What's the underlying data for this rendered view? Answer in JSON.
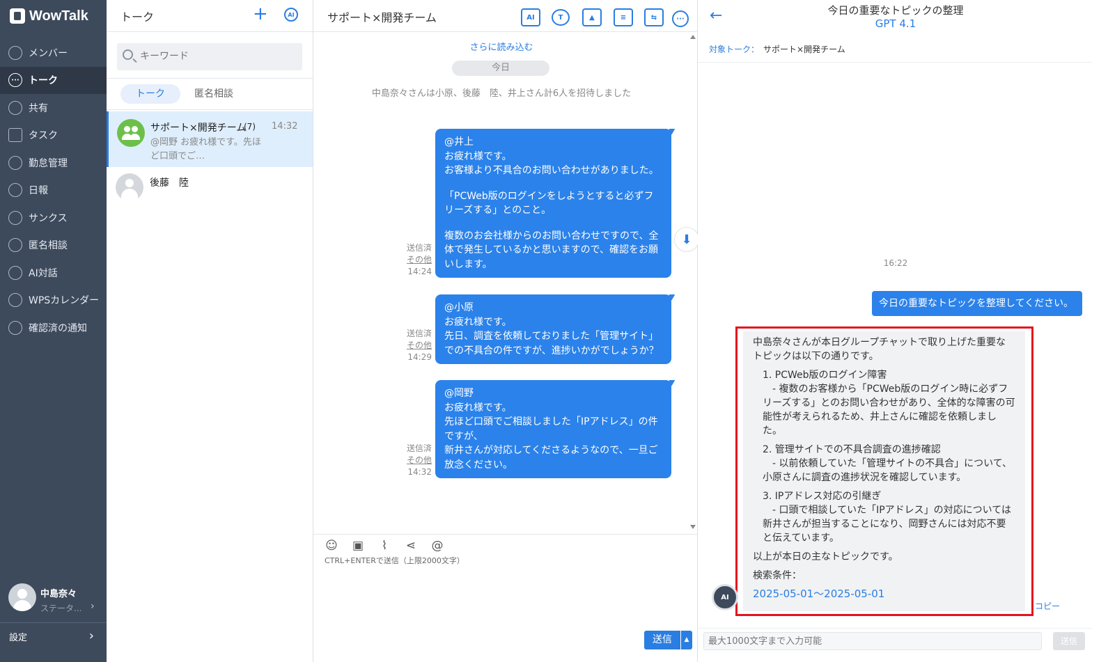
{
  "app": {
    "logo": "WowTalk"
  },
  "nav": {
    "items": [
      {
        "label": "メンバー",
        "icon": "members-icon"
      },
      {
        "label": "トーク",
        "icon": "talk-icon",
        "active": true
      },
      {
        "label": "共有",
        "icon": "share-icon"
      },
      {
        "label": "タスク",
        "icon": "task-icon"
      },
      {
        "label": "勤怠管理",
        "icon": "attendance-icon"
      },
      {
        "label": "日報",
        "icon": "daily-report-icon"
      },
      {
        "label": "サンクス",
        "icon": "thanks-icon"
      },
      {
        "label": "匿名相談",
        "icon": "anonymous-icon"
      },
      {
        "label": "AI対話",
        "icon": "ai-icon"
      },
      {
        "label": "WPSカレンダー",
        "icon": "calendar-icon"
      },
      {
        "label": "確認済の通知",
        "icon": "notification-icon"
      }
    ],
    "profile": {
      "name": "中島奈々",
      "status": "ステータ..."
    },
    "settings": "設定"
  },
  "talklist": {
    "title": "トーク",
    "search_placeholder": "キーワード",
    "tabs": [
      "トーク",
      "匿名相談"
    ],
    "conversations": [
      {
        "name": "サポート×開発チーム",
        "count": "(7)",
        "time": "14:32",
        "preview": "@岡野 お疲れ様です。先ほど口頭でご…"
      },
      {
        "name": "後藤　陸"
      }
    ]
  },
  "chat": {
    "title": "サポート×開発チーム",
    "load_more": "さらに読み込む",
    "date": "今日",
    "system": "中島奈々さんは小原、後藤　陸、井上さん計6人を招待しました",
    "messages": [
      {
        "paragraphs": [
          "@井上\nお疲れ様です。\nお客様より不具合のお問い合わせがありました。",
          "「PCWeb版のログインをしようとすると必ずフリーズする」とのこと。",
          "複数のお会社様からのお問い合わせですので、全体で発生しているかと思いますので、確認をお願いします。"
        ],
        "status": "送信済",
        "other": "その他",
        "time": "14:24"
      },
      {
        "paragraphs": [
          "@小原\nお疲れ様です。\n先日、調査を依頼しておりました「管理サイト」での不具合の件ですが、進捗いかがでしょうか？"
        ],
        "status": "送信済",
        "other": "その他",
        "time": "14:29"
      },
      {
        "paragraphs": [
          "@岡野\nお疲れ様です。\n先ほど口頭でご相談しました「IPアドレス」の件ですが、\n新井さんが対応してくださるようなので、一旦ご放念ください。"
        ],
        "status": "送信済",
        "other": "その他",
        "time": "14:32"
      }
    ],
    "composer_hint": "CTRL+ENTERで送信（上限2000文字）",
    "send": "送信"
  },
  "ai_panel": {
    "title": "今日の重要なトピックの整理",
    "model": "GPT 4.1",
    "target_label": "対象トーク：",
    "target_value": "サポート×開発チーム",
    "time": "16:22",
    "user_message": "今日の重要なトピックを整理してください。",
    "response": {
      "intro": "中島奈々さんが本日グループチャットで取り上げた重要なトピックは以下の通りです。",
      "items": [
        {
          "title": "1. PCWeb版のログイン障害",
          "body": "　- 複数のお客様から「PCWeb版のログイン時に必ずフリーズする」とのお問い合わせがあり、全体的な障害の可能性が考えられるため、井上さんに確認を依頼しました。"
        },
        {
          "title": "2. 管理サイトでの不具合調査の進捗確認",
          "body": "　- 以前依頼していた「管理サイトの不具合」について、小原さんに調査の進捗状況を確認しています。"
        },
        {
          "title": "3. IPアドレス対応の引継ぎ",
          "body": "　- 口頭で相談していた「IPアドレス」の対応については新井さんが担当することになり、岡野さんには対応不要と伝えています。"
        }
      ],
      "outro": "以上が本日の主なトピックです。",
      "criteria_label": "検索条件：",
      "criteria_value": "2025-05-01～2025-05-01"
    },
    "copy": "コピー",
    "input_placeholder": "最大1000文字まで入力可能",
    "send": "送信"
  }
}
